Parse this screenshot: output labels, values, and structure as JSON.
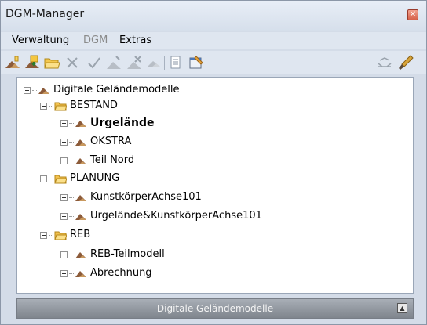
{
  "window": {
    "title": "DGM-Manager",
    "close_icon": "close-icon"
  },
  "menu": {
    "items": [
      "Verwaltung",
      "DGM",
      "Extras"
    ]
  },
  "toolbar": {
    "icons": [
      "new-model-icon",
      "import-icon",
      "open-folder-icon",
      "delete-icon",
      "check-icon",
      "terrain-edit-icon",
      "terrain-delete-icon",
      "terrain-icon",
      "document-icon",
      "properties-icon",
      "fit-icon",
      "brush-icon"
    ]
  },
  "tree": {
    "root": "Digitale Geländemodelle",
    "groups": [
      {
        "label": "BESTAND",
        "items": [
          "Urgelände",
          "OKSTRA",
          "Teil Nord"
        ]
      },
      {
        "label": "PLANUNG",
        "items": [
          "KunstkörperAchse101",
          "Urgelände&KunstkörperAchse101"
        ]
      },
      {
        "label": "REB",
        "items": [
          "REB-Teilmodell",
          "Abrechnung"
        ]
      }
    ],
    "active_item": "Urgelände"
  },
  "statusbar": {
    "label": "Digitale Geländemodelle"
  },
  "colors": {
    "terrain_icon": "#8c5b3a",
    "folder": "#f2c14e",
    "window_bg": "#d4dce8"
  }
}
